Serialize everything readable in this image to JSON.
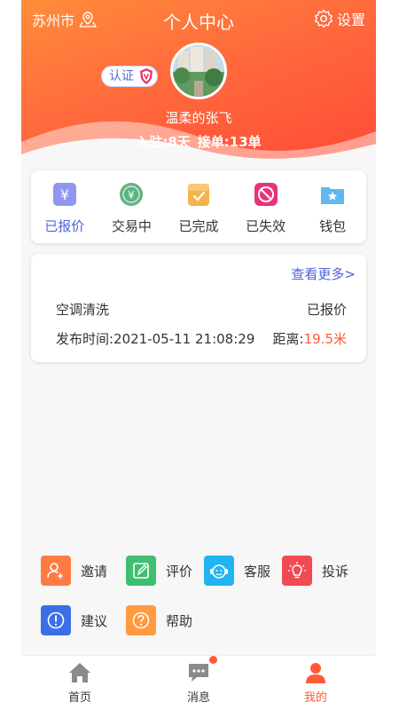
{
  "header": {
    "city": "苏州市",
    "title": "个人中心",
    "settings_label": "设置",
    "badge": "认证",
    "username": "温柔的张飞",
    "days": "入驻:8天",
    "orders": "接单:13单"
  },
  "status_tabs": [
    {
      "label": "已报价",
      "icon": "price-tag-icon",
      "color": "#8f96f0"
    },
    {
      "label": "交易中",
      "icon": "yuan-coin-icon",
      "color": "#5fb383"
    },
    {
      "label": "已完成",
      "icon": "clipboard-check-icon",
      "color": "#f6b24e"
    },
    {
      "label": "已失效",
      "icon": "forbidden-icon",
      "color": "#e8337a"
    },
    {
      "label": "钱包",
      "icon": "wallet-folder-icon",
      "color": "#5fb8ee"
    }
  ],
  "order_card": {
    "more_label": "查看更多>",
    "service": "空调清洗",
    "status": "已报价",
    "time": "发布时间:2021-05-11 21:08:29",
    "distance_label": "距离:",
    "distance_value": "19.5米"
  },
  "tools": [
    {
      "label": "邀请",
      "icon": "add-user-icon",
      "color": "#ff7b42"
    },
    {
      "label": "评价",
      "icon": "edit-icon",
      "color": "#3fbf6f"
    },
    {
      "label": "客服",
      "icon": "headset-icon",
      "color": "#1fb6f0"
    },
    {
      "label": "投诉",
      "icon": "bulb-icon",
      "color": "#f24a53"
    },
    {
      "label": "建议",
      "icon": "info-icon",
      "color": "#3b6fe6"
    },
    {
      "label": "帮助",
      "icon": "help-icon",
      "color": "#ff9a3e"
    }
  ],
  "tabbar": [
    {
      "label": "首页",
      "icon": "home-icon"
    },
    {
      "label": "消息",
      "icon": "message-icon",
      "has_dot": true
    },
    {
      "label": "我的",
      "icon": "user-icon",
      "active": true
    }
  ],
  "colors": {
    "accent": "#ff5a36",
    "link": "#4c63d8"
  }
}
